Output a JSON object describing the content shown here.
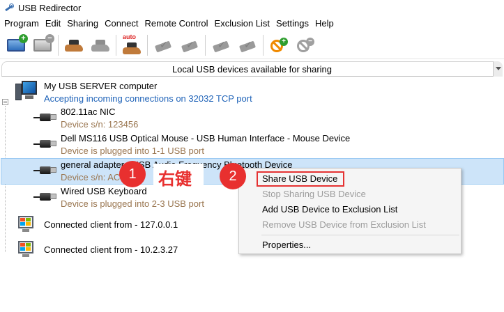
{
  "window": {
    "title": "USB Redirector"
  },
  "menu": [
    "Program",
    "Edit",
    "Sharing",
    "Connect",
    "Remote Control",
    "Exclusion List",
    "Settings",
    "Help"
  ],
  "toolbar": {
    "auto_label": "auto"
  },
  "panel": {
    "header": "Local USB devices available for sharing"
  },
  "tree": {
    "server": {
      "name": "My USB SERVER computer",
      "status": "Accepting incoming connections on 32032 TCP port"
    },
    "devices": [
      {
        "name": "802.11ac NIC",
        "detail": "Device s/n: 123456"
      },
      {
        "name": "Dell MS116 USB Optical Mouse - USB Human Interface - Mouse Device",
        "detail": "Device is plugged into 1-1 USB port"
      },
      {
        "name": "general adapter - USB Audio Frequency Bluetooth Device",
        "detail": "Device s/n: AC"
      },
      {
        "name": "Wired USB Keyboard",
        "detail": "Device is plugged into 2-3 USB port"
      }
    ],
    "clients": [
      {
        "label": "Connected client from - 127.0.0.1"
      },
      {
        "label": "Connected client from - 10.2.3.27"
      }
    ]
  },
  "context_menu": {
    "share": "Share USB Device",
    "stop_sharing": "Stop Sharing USB Device",
    "add_exclusion": "Add USB Device to Exclusion List",
    "remove_exclusion": "Remove USB Device from Exclusion List",
    "properties": "Properties..."
  },
  "annotations": {
    "step1": "1",
    "step2": "2",
    "right_click": "右键"
  }
}
